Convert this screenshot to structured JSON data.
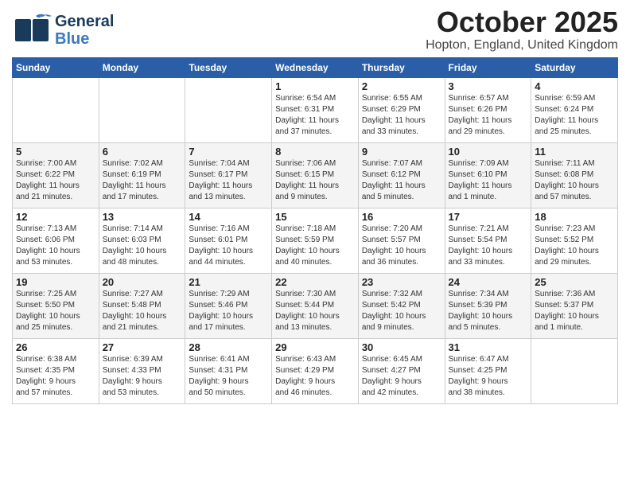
{
  "header": {
    "logo_general": "General",
    "logo_blue": "Blue",
    "month": "October 2025",
    "location": "Hopton, England, United Kingdom"
  },
  "days_of_week": [
    "Sunday",
    "Monday",
    "Tuesday",
    "Wednesday",
    "Thursday",
    "Friday",
    "Saturday"
  ],
  "weeks": [
    [
      {
        "day": "",
        "info": ""
      },
      {
        "day": "",
        "info": ""
      },
      {
        "day": "",
        "info": ""
      },
      {
        "day": "1",
        "info": "Sunrise: 6:54 AM\nSunset: 6:31 PM\nDaylight: 11 hours\nand 37 minutes."
      },
      {
        "day": "2",
        "info": "Sunrise: 6:55 AM\nSunset: 6:29 PM\nDaylight: 11 hours\nand 33 minutes."
      },
      {
        "day": "3",
        "info": "Sunrise: 6:57 AM\nSunset: 6:26 PM\nDaylight: 11 hours\nand 29 minutes."
      },
      {
        "day": "4",
        "info": "Sunrise: 6:59 AM\nSunset: 6:24 PM\nDaylight: 11 hours\nand 25 minutes."
      }
    ],
    [
      {
        "day": "5",
        "info": "Sunrise: 7:00 AM\nSunset: 6:22 PM\nDaylight: 11 hours\nand 21 minutes."
      },
      {
        "day": "6",
        "info": "Sunrise: 7:02 AM\nSunset: 6:19 PM\nDaylight: 11 hours\nand 17 minutes."
      },
      {
        "day": "7",
        "info": "Sunrise: 7:04 AM\nSunset: 6:17 PM\nDaylight: 11 hours\nand 13 minutes."
      },
      {
        "day": "8",
        "info": "Sunrise: 7:06 AM\nSunset: 6:15 PM\nDaylight: 11 hours\nand 9 minutes."
      },
      {
        "day": "9",
        "info": "Sunrise: 7:07 AM\nSunset: 6:12 PM\nDaylight: 11 hours\nand 5 minutes."
      },
      {
        "day": "10",
        "info": "Sunrise: 7:09 AM\nSunset: 6:10 PM\nDaylight: 11 hours\nand 1 minute."
      },
      {
        "day": "11",
        "info": "Sunrise: 7:11 AM\nSunset: 6:08 PM\nDaylight: 10 hours\nand 57 minutes."
      }
    ],
    [
      {
        "day": "12",
        "info": "Sunrise: 7:13 AM\nSunset: 6:06 PM\nDaylight: 10 hours\nand 53 minutes."
      },
      {
        "day": "13",
        "info": "Sunrise: 7:14 AM\nSunset: 6:03 PM\nDaylight: 10 hours\nand 48 minutes."
      },
      {
        "day": "14",
        "info": "Sunrise: 7:16 AM\nSunset: 6:01 PM\nDaylight: 10 hours\nand 44 minutes."
      },
      {
        "day": "15",
        "info": "Sunrise: 7:18 AM\nSunset: 5:59 PM\nDaylight: 10 hours\nand 40 minutes."
      },
      {
        "day": "16",
        "info": "Sunrise: 7:20 AM\nSunset: 5:57 PM\nDaylight: 10 hours\nand 36 minutes."
      },
      {
        "day": "17",
        "info": "Sunrise: 7:21 AM\nSunset: 5:54 PM\nDaylight: 10 hours\nand 33 minutes."
      },
      {
        "day": "18",
        "info": "Sunrise: 7:23 AM\nSunset: 5:52 PM\nDaylight: 10 hours\nand 29 minutes."
      }
    ],
    [
      {
        "day": "19",
        "info": "Sunrise: 7:25 AM\nSunset: 5:50 PM\nDaylight: 10 hours\nand 25 minutes."
      },
      {
        "day": "20",
        "info": "Sunrise: 7:27 AM\nSunset: 5:48 PM\nDaylight: 10 hours\nand 21 minutes."
      },
      {
        "day": "21",
        "info": "Sunrise: 7:29 AM\nSunset: 5:46 PM\nDaylight: 10 hours\nand 17 minutes."
      },
      {
        "day": "22",
        "info": "Sunrise: 7:30 AM\nSunset: 5:44 PM\nDaylight: 10 hours\nand 13 minutes."
      },
      {
        "day": "23",
        "info": "Sunrise: 7:32 AM\nSunset: 5:42 PM\nDaylight: 10 hours\nand 9 minutes."
      },
      {
        "day": "24",
        "info": "Sunrise: 7:34 AM\nSunset: 5:39 PM\nDaylight: 10 hours\nand 5 minutes."
      },
      {
        "day": "25",
        "info": "Sunrise: 7:36 AM\nSunset: 5:37 PM\nDaylight: 10 hours\nand 1 minute."
      }
    ],
    [
      {
        "day": "26",
        "info": "Sunrise: 6:38 AM\nSunset: 4:35 PM\nDaylight: 9 hours\nand 57 minutes."
      },
      {
        "day": "27",
        "info": "Sunrise: 6:39 AM\nSunset: 4:33 PM\nDaylight: 9 hours\nand 53 minutes."
      },
      {
        "day": "28",
        "info": "Sunrise: 6:41 AM\nSunset: 4:31 PM\nDaylight: 9 hours\nand 50 minutes."
      },
      {
        "day": "29",
        "info": "Sunrise: 6:43 AM\nSunset: 4:29 PM\nDaylight: 9 hours\nand 46 minutes."
      },
      {
        "day": "30",
        "info": "Sunrise: 6:45 AM\nSunset: 4:27 PM\nDaylight: 9 hours\nand 42 minutes."
      },
      {
        "day": "31",
        "info": "Sunrise: 6:47 AM\nSunset: 4:25 PM\nDaylight: 9 hours\nand 38 minutes."
      },
      {
        "day": "",
        "info": ""
      }
    ]
  ]
}
